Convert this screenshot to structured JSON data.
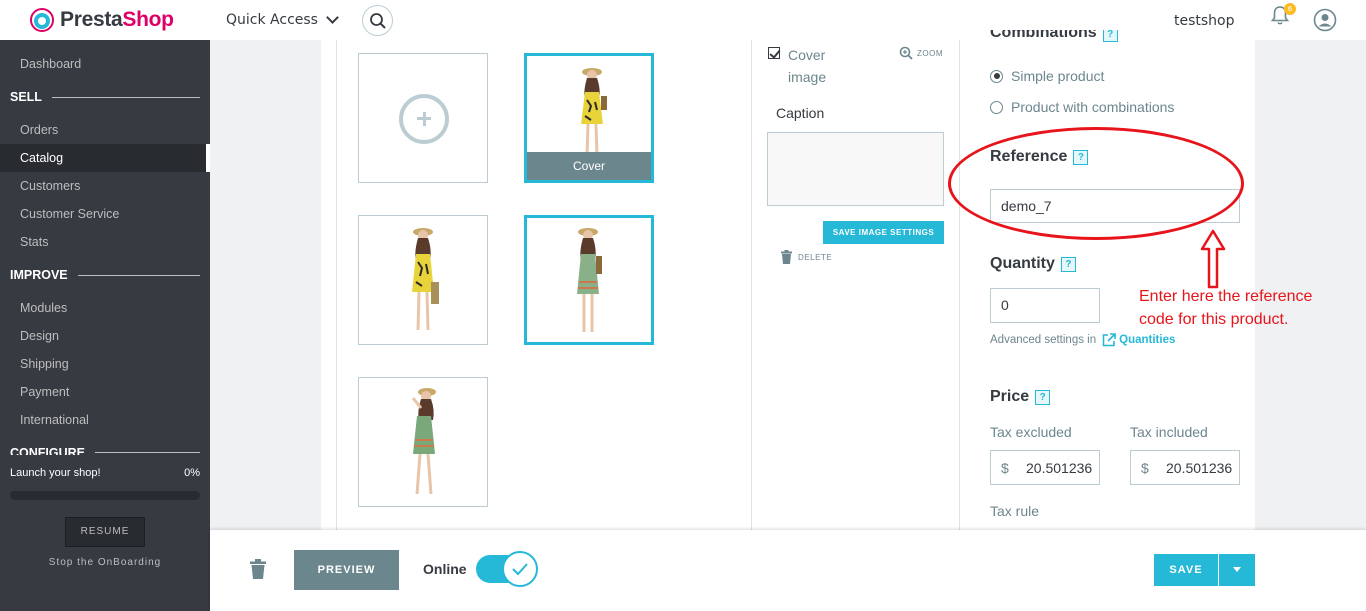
{
  "header": {
    "logo_presta": "Presta",
    "logo_shop": "Shop",
    "quick_access": "Quick Access",
    "shop_name": "testshop",
    "notification_count": "6"
  },
  "sidebar": {
    "items": [
      {
        "label": "Dashboard"
      },
      {
        "label": "Orders"
      },
      {
        "label": "Catalog"
      },
      {
        "label": "Customers"
      },
      {
        "label": "Customer Service"
      },
      {
        "label": "Stats"
      },
      {
        "label": "Modules"
      },
      {
        "label": "Design"
      },
      {
        "label": "Shipping"
      },
      {
        "label": "Payment"
      },
      {
        "label": "International"
      }
    ],
    "sections": {
      "sell": "SELL",
      "improve": "IMPROVE",
      "configure": "CONFIGURE"
    },
    "launch_label": "Launch your shop!",
    "launch_percent": "0%",
    "launch_progress": 0,
    "resume_label": "RESUME",
    "stop_onboarding": "Stop the OnBoarding"
  },
  "images": {
    "cover_label": "Cover",
    "cover_image_checkbox": "Cover image",
    "zoom_label": "ZOOM",
    "caption_label": "Caption",
    "caption_value": "",
    "save_settings_label": "SAVE IMAGE SETTINGS",
    "delete_label": "DELETE"
  },
  "right": {
    "combinations_title": "Combinations",
    "simple_product": "Simple product",
    "product_with_combinations": "Product with combinations",
    "reference_title": "Reference",
    "reference_value": "demo_7",
    "quantity_title": "Quantity",
    "quantity_value": "0",
    "advanced_settings": "Advanced settings in",
    "quantities_link": "Quantities",
    "price_title": "Price",
    "tax_excluded": "Tax excluded",
    "tax_included": "Tax included",
    "currency": "$",
    "price_excl": "20.501236",
    "price_incl": "20.501236",
    "tax_rule": "Tax rule",
    "help_mark": "?"
  },
  "annotation": {
    "text": "Enter here the reference code for this product.",
    "color": "#e8141b"
  },
  "footer": {
    "preview_label": "PREVIEW",
    "online_label": "Online",
    "save_label": "SAVE"
  },
  "colors": {
    "accent": "#25b9d7",
    "sidebar": "#363a41",
    "brand_pink": "#df0067"
  }
}
